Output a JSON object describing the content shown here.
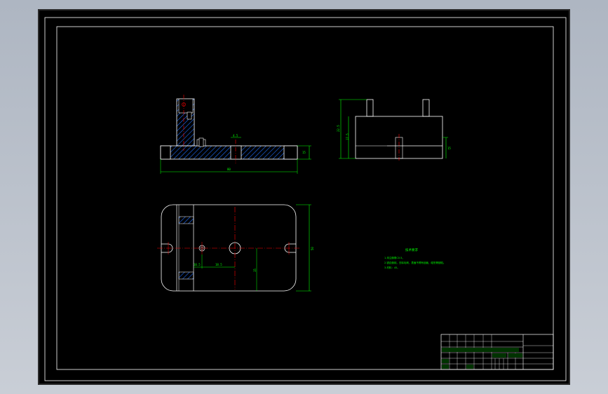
{
  "drawing": {
    "colors": {
      "background": "#000000",
      "outline": "#ffffff",
      "dimension": "#00ff00",
      "centerline": "#ff0000",
      "hatch": "#1f6fff",
      "title_block_text": "#00ff00"
    },
    "front_view": {
      "overall_length_label": "80",
      "height_label_right": "15",
      "slot_label": "4.5"
    },
    "side_view": {
      "height_label_outer": "22.5",
      "height_label_inner": "17.5",
      "right_label": "15"
    },
    "top_view": {
      "width_label": "50",
      "offset_label_1": "10.5",
      "offset_label_2": "18.5",
      "depth_label": "15"
    },
    "notes": {
      "heading": "技术要求",
      "line1": "1.未注倒角C0.5。",
      "line2": "2.锐边倒钝，去除毛刺，表面不得有划痕、碰伤等缺陷。",
      "line3": "3.材料：45。"
    },
    "title_block": {
      "cells": [
        "",
        "",
        "",
        "",
        "",
        "",
        ""
      ]
    }
  }
}
